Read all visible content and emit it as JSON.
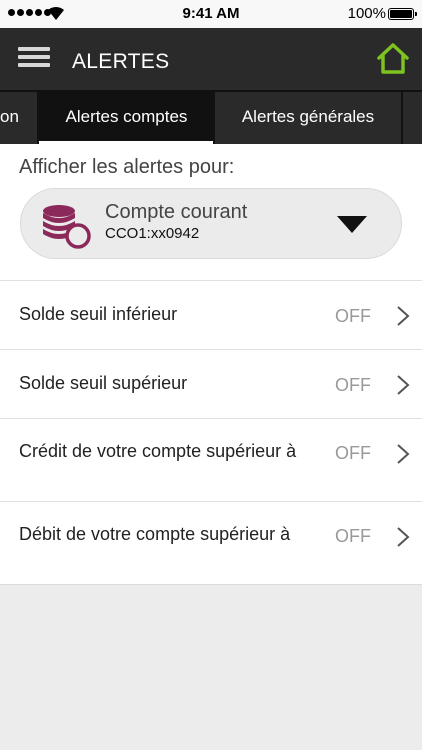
{
  "status_bar": {
    "time": "9:41 AM",
    "battery": "100%",
    "battery_level": 1.0
  },
  "header": {
    "title": "ALERTES",
    "menu_icon": "hamburger-menu-icon",
    "home_icon": "home-icon",
    "home_color": "#7dc21e"
  },
  "tabs": [
    {
      "label": "on",
      "selected": false
    },
    {
      "label": "Alertes comptes",
      "selected": true
    },
    {
      "label": "Alertes générales",
      "selected": false
    }
  ],
  "account_selector": {
    "prompt": "Afficher les alertes pour:",
    "account_name": "Compte courant",
    "account_number": "CCO1:xx0942",
    "icon": "coins-icon",
    "icon_color": "#8b2a5a"
  },
  "alerts": [
    {
      "label": "Solde seuil inférieur",
      "state": "OFF"
    },
    {
      "label": "Solde seuil supérieur",
      "state": "OFF"
    },
    {
      "label": "Crédit de votre compte supérieur à",
      "state": "OFF"
    },
    {
      "label": "Débit de votre compte supérieur à",
      "state": "OFF"
    }
  ]
}
